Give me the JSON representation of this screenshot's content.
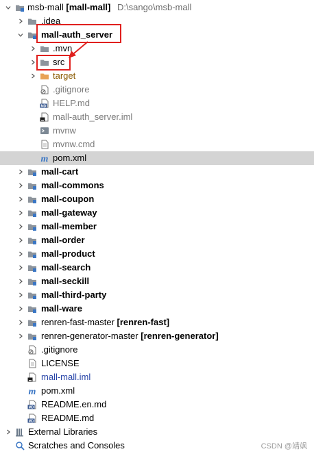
{
  "tree": {
    "root": {
      "name": "msb-mall",
      "module": "[mall-mall]",
      "path": "D:\\sango\\msb-mall"
    },
    "idea": ".idea",
    "auth": {
      "name": "mall-auth_server",
      "children": {
        "mvn": ".mvn",
        "src": "src",
        "target": "target",
        "gitignore": ".gitignore",
        "help": "HELP.md",
        "iml": "mall-auth_server.iml",
        "mvnw": "mvnw",
        "mvnw_cmd": "mvnw.cmd",
        "pom": "pom.xml"
      }
    },
    "modules": [
      "mall-cart",
      "mall-commons",
      "mall-coupon",
      "mall-gateway",
      "mall-member",
      "mall-order",
      "mall-product",
      "mall-search",
      "mall-seckill",
      "mall-third-party",
      "mall-ware"
    ],
    "renren_fast": {
      "name": "renren-fast-master",
      "module": "[renren-fast]"
    },
    "renren_generator": {
      "name": "renren-generator-master",
      "module": "[renren-generator]"
    },
    "root_files": {
      "gitignore": ".gitignore",
      "license": "LICENSE",
      "iml": "mall-mall.iml",
      "pom": "pom.xml",
      "readme_en": "README.en.md",
      "readme": "README.md"
    },
    "external_libraries": "External Libraries",
    "scratches": "Scratches and Consoles"
  },
  "watermark": "CSDN @靖飒",
  "colors": {
    "folder": "#8d949c",
    "source_folder": "#5b8bd6",
    "excluded_folder": "#e8a256",
    "annotation": "#e0201e",
    "selection": "#d4d4d4",
    "maven": "#3a76c4"
  }
}
